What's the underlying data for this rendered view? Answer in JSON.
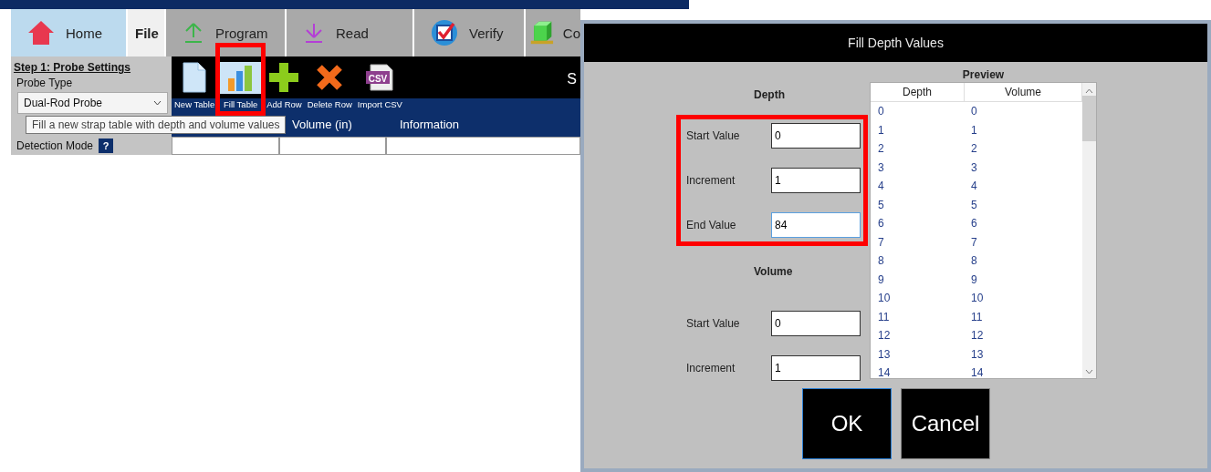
{
  "app": {
    "tabs": [
      {
        "label": "Home",
        "kind": "home",
        "selected": true
      },
      {
        "label": "File",
        "kind": "file",
        "selected": false
      },
      {
        "label": "Program",
        "kind": "upload",
        "selected": false
      },
      {
        "label": "Read",
        "kind": "download",
        "selected": false
      },
      {
        "label": "Verify",
        "kind": "check",
        "selected": false
      },
      {
        "label": "Co",
        "kind": "cube",
        "selected": false
      }
    ],
    "settings": {
      "step_title": "Step 1: Probe Settings",
      "probe_type_label": "Probe Type",
      "probe_type_value": "Dual-Rod Probe",
      "detection_mode_label": "Detection Mode",
      "help_mark": "?"
    },
    "toolbar": {
      "items": [
        {
          "label": "New Table",
          "kind": "document",
          "hovered": false,
          "annotated": false
        },
        {
          "label": "Fill Table",
          "kind": "chart",
          "hovered": true,
          "annotated": true
        },
        {
          "label": "Add Row",
          "kind": "plus",
          "hovered": false,
          "annotated": false
        },
        {
          "label": "Delete Row",
          "kind": "cross",
          "hovered": false,
          "annotated": false
        },
        {
          "label": "Import CSV",
          "kind": "csv",
          "icon_text": "CSV",
          "hovered": false,
          "annotated": false
        }
      ],
      "title_fragment": "S"
    },
    "tooltip": "Fill a new strap table with depth and volume values",
    "table": {
      "columns": [
        "Volume (in)",
        "Information"
      ]
    }
  },
  "dialog": {
    "title": "Fill Depth Values",
    "depth": {
      "heading": "Depth",
      "annotated": true,
      "fields": [
        {
          "label": "Start Value",
          "value": "0",
          "focused": false
        },
        {
          "label": "Increment",
          "value": "1",
          "focused": false
        },
        {
          "label": "End Value",
          "value": "84",
          "focused": true
        }
      ]
    },
    "volume": {
      "heading": "Volume",
      "annotated": false,
      "fields": [
        {
          "label": "Start Value",
          "value": "0",
          "focused": false
        },
        {
          "label": "Increment",
          "value": "1",
          "focused": false
        }
      ]
    },
    "preview": {
      "heading": "Preview",
      "columns": [
        "Depth",
        "Volume"
      ],
      "rows": [
        {
          "depth": "0",
          "volume": "0"
        },
        {
          "depth": "1",
          "volume": "1"
        },
        {
          "depth": "2",
          "volume": "2"
        },
        {
          "depth": "3",
          "volume": "3"
        },
        {
          "depth": "4",
          "volume": "4"
        },
        {
          "depth": "5",
          "volume": "5"
        },
        {
          "depth": "6",
          "volume": "6"
        },
        {
          "depth": "7",
          "volume": "7"
        },
        {
          "depth": "8",
          "volume": "8"
        },
        {
          "depth": "9",
          "volume": "9"
        },
        {
          "depth": "10",
          "volume": "10"
        },
        {
          "depth": "11",
          "volume": "11"
        },
        {
          "depth": "12",
          "volume": "12"
        },
        {
          "depth": "13",
          "volume": "13"
        },
        {
          "depth": "14",
          "volume": "14"
        }
      ]
    },
    "buttons": [
      {
        "label": "OK",
        "kind": "primary"
      },
      {
        "label": "Cancel",
        "kind": "secondary"
      }
    ]
  }
}
